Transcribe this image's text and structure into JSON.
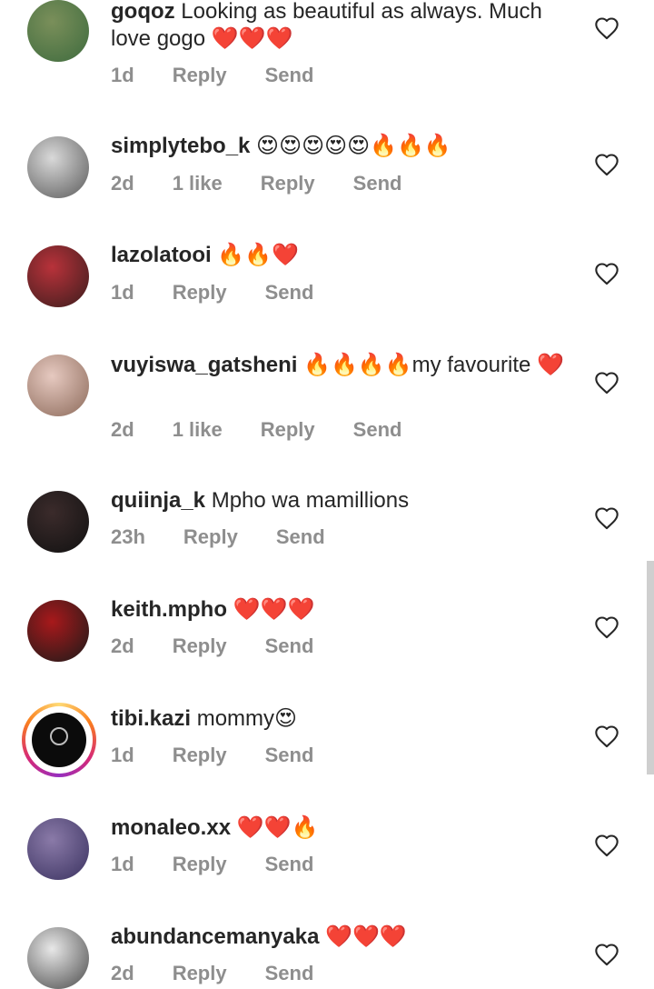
{
  "comments": [
    {
      "username": "goqoz",
      "text": " Looking as beautiful as always. Much love gogo ❤️❤️❤️",
      "time": "1d",
      "likes": "",
      "reply": "Reply",
      "send": "Send",
      "avatar_colors": [
        "#7a8f5a",
        "#3e6b3e"
      ]
    },
    {
      "username": "simplytebo_k",
      "text": " 😍😍😍😍😍🔥🔥🔥",
      "time": "2d",
      "likes": "1 like",
      "reply": "Reply",
      "send": "Send",
      "avatar_colors": [
        "#d9d9d9",
        "#5a5a5a"
      ]
    },
    {
      "username": "lazolatooi",
      "text": " 🔥🔥❤️",
      "time": "1d",
      "likes": "",
      "reply": "Reply",
      "send": "Send",
      "avatar_colors": [
        "#b8323a",
        "#3b1d1d"
      ]
    },
    {
      "username": "vuyiswa_gatsheni",
      "text": " 🔥🔥🔥🔥my favourite ❤️",
      "time": "2d",
      "likes": "1 like",
      "reply": "Reply",
      "send": "Send",
      "avatar_colors": [
        "#e6c9c0",
        "#8c6a5a"
      ]
    },
    {
      "username": "quiinja_k",
      "text": " Mpho wa mamillions",
      "time": "23h",
      "likes": "",
      "reply": "Reply",
      "send": "Send",
      "avatar_colors": [
        "#3b2b2b",
        "#111111"
      ]
    },
    {
      "username": "keith.mpho",
      "text": " ❤️❤️❤️",
      "time": "2d",
      "likes": "",
      "reply": "Reply",
      "send": "Send",
      "avatar_colors": [
        "#a8191b",
        "#1a1a1a"
      ]
    },
    {
      "username": "tibi.kazi",
      "text": " mommy😍",
      "time": "1d",
      "likes": "",
      "reply": "Reply",
      "send": "Send",
      "avatar_colors": [
        "#0b0b0b",
        "#0b0b0b"
      ]
    },
    {
      "username": "monaleo.xx",
      "text": " ❤️❤️🔥",
      "time": "1d",
      "likes": "",
      "reply": "Reply",
      "send": "Send",
      "avatar_colors": [
        "#8a7aa8",
        "#3a3260"
      ]
    },
    {
      "username": "abundancemanyaka",
      "text": " ❤️❤️❤️",
      "time": "2d",
      "likes": "",
      "reply": "Reply",
      "send": "Send",
      "avatar_colors": [
        "#e8e8e8",
        "#4a4a4a"
      ]
    }
  ],
  "icons": {
    "like": "heart-outline-icon"
  },
  "colors": {
    "meta": "#8e8e8e",
    "text": "#262626",
    "story_ring": "#d62976"
  }
}
